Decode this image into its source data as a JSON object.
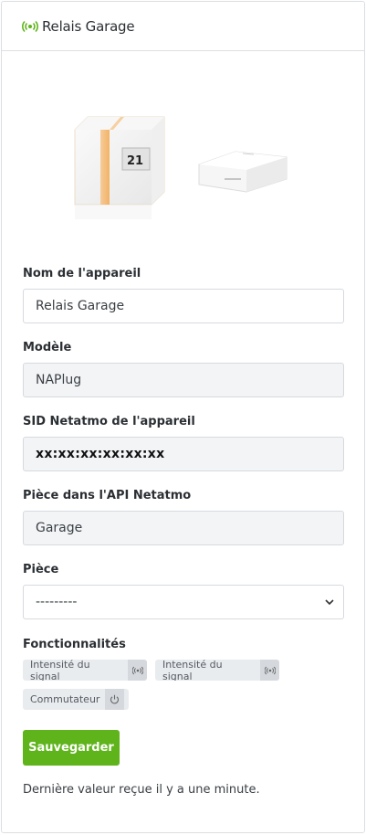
{
  "header": {
    "title": "Relais Garage",
    "icon": "signal-broadcast-icon",
    "icon_color": "#5fb41b"
  },
  "device_image": {
    "thermostat_display": "21"
  },
  "form": {
    "device_name": {
      "label": "Nom de l'appareil",
      "value": "Relais Garage"
    },
    "model": {
      "label": "Modèle",
      "value": "NAPlug"
    },
    "sid": {
      "label": "SID Netatmo de l'appareil",
      "value": "xx:xx:xx:xx:xx:xx"
    },
    "api_room": {
      "label": "Pièce dans l'API Netatmo",
      "value": "Garage"
    },
    "room": {
      "label": "Pièce",
      "selected": "---------"
    }
  },
  "features": {
    "label": "Fonctionnalités",
    "items": [
      {
        "label": "Intensité du signal",
        "icon": "signal-icon"
      },
      {
        "label": "Intensité du signal",
        "icon": "signal-icon"
      },
      {
        "label": "Commutateur",
        "icon": "power-icon"
      }
    ]
  },
  "actions": {
    "save_label": "Sauvegarder",
    "save_color": "#5fb41b"
  },
  "status": {
    "last_value": "Dernière valeur reçue il y a une minute."
  }
}
